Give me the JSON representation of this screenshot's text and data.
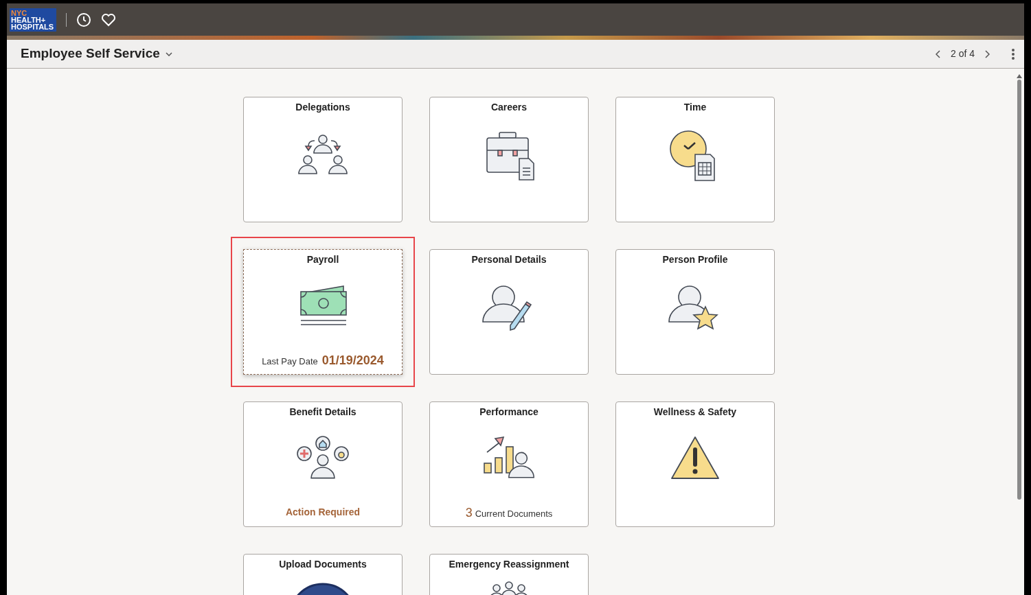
{
  "header": {
    "logo": [
      "NYC",
      "HEALTH+",
      "HOSPITALS"
    ]
  },
  "title_bar": {
    "title": "Employee Self Service",
    "pager": "2 of 4"
  },
  "tiles": [
    {
      "title": "Delegations",
      "highlighted": false
    },
    {
      "title": "Careers",
      "highlighted": false
    },
    {
      "title": "Time",
      "highlighted": false
    },
    {
      "title": "Payroll",
      "highlighted": true,
      "footer": {
        "kind": "date",
        "label": "Last Pay Date",
        "value": "01/19/2024"
      }
    },
    {
      "title": "Personal Details",
      "highlighted": false
    },
    {
      "title": "Person Profile",
      "highlighted": false
    },
    {
      "title": "Benefit Details",
      "highlighted": false,
      "footer": {
        "kind": "status",
        "value": "Action Required"
      }
    },
    {
      "title": "Performance",
      "highlighted": false,
      "footer": {
        "kind": "count",
        "value": "3",
        "label": "Current Documents"
      }
    },
    {
      "title": "Wellness & Safety",
      "highlighted": false
    },
    {
      "title": "Upload Documents",
      "highlighted": false
    },
    {
      "title": "Emergency Reassignment",
      "highlighted": false
    }
  ]
}
